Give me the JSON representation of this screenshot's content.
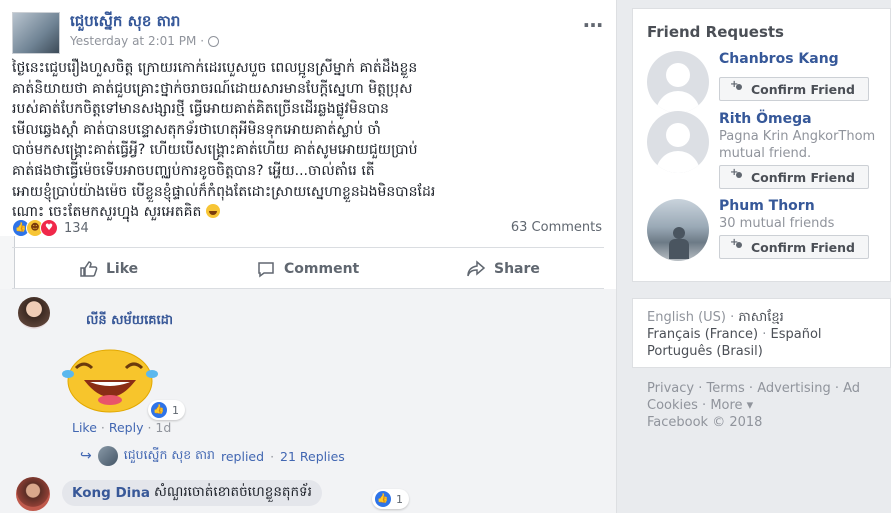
{
  "post": {
    "author": "ជេួបស្នេីក សុខ តារា",
    "timestamp": "Yesterday at 2:01 PM",
    "privacy_separator": "·",
    "more_icon": "…",
    "text_lines": [
      "ថ្ងៃនេះជេួបរឿងហួសចិត្ត ក្រោយរកោក់ដេរបេួសបួច ពេលប្អូនស្រីម្នាក់ គាត់ដឹងខ្លួន",
      "គាត់និយាយថា គាត់ជួបគ្រោះថ្នាក់ចរាចរណ៍ដោយសារមានបែក្ដីស្នេហា មិត្តប្រុស",
      "របស់គាត់បែកចិត្តទៅមានសង្សារថ្មី ធ្វើអោយគាត់គិតច្រើនដើរឆ្លងផ្លូវមិនបាន",
      "មើលឆ្វេងស្ដាំ គាត់បានបន្ទោសតុកទ័រថាហេតុអីមិនទុកអោយគាត់ស្លាប់ ចាំ",
      "បាច់មកសង្គ្រោះគាត់ធ្វើអ្វី? ហើយបើសង្គ្រោះគាត់ហើយ គាត់សូមអោយជួយប្រាប់",
      "គាត់ផងថាធ្វើម៉េចទើបអាចបញ្ឈប់ការខូចចិត្តបាន? អ្ហើយ...ចាល់តាំរេ តើ",
      "អោយខ្ញុំប្រាប់យ៉ាងម៉េច បើខ្លួនខ្ញុំផ្ទាល់ក៏កំពុងតែដោះស្រាយស្នេហាខ្លួនឯងមិនបានដែរ",
      "ណោះ  ចេះតែមកសួរហ្នុង សួរអេតគិត"
    ],
    "reaction_count": "134",
    "comments_count": "63 Comments",
    "actions": {
      "like": "Like",
      "comment": "Comment",
      "share": "Share"
    }
  },
  "comments": [
    {
      "name": "លីនី សម័យគេដោ",
      "reaction_count": "1",
      "like": "Like",
      "reply": "Reply",
      "time": "1d",
      "replies": {
        "name": "ជេួបស្នេីក សុខ តារា",
        "replied": "replied",
        "count": "21 Replies"
      }
    },
    {
      "name": "Kong Dina",
      "text": "សំណួរចោត់ខោតច់ហេខ្លួនតុកទ័រ",
      "reaction_count": "1"
    }
  ],
  "sidebar": {
    "title": "Friend Requests",
    "requests": [
      {
        "name": "Chanbros Kang",
        "sub": "",
        "button": "Confirm Friend"
      },
      {
        "name": "Rith Ömega",
        "sub": "Pagna Krin AngkorThom",
        "sub2": "mutual friend.",
        "button": "Confirm Friend"
      },
      {
        "name": "Phum Thorn",
        "sub": "30 mutual friends",
        "button": "Confirm Friend"
      }
    ],
    "languages": {
      "current": "English (US)",
      "items": [
        "ភាសាខ្មែរ",
        "Français (France)",
        "Español",
        "Português (Brasil)"
      ]
    },
    "footer": {
      "links": [
        "Privacy",
        "Terms",
        "Advertising",
        "Ad",
        "Cookies",
        "More"
      ],
      "copyright": "Facebook © 2018"
    }
  },
  "colors": {
    "link": "#365899",
    "accent": "#4267b2",
    "background": "#e9ebee"
  }
}
